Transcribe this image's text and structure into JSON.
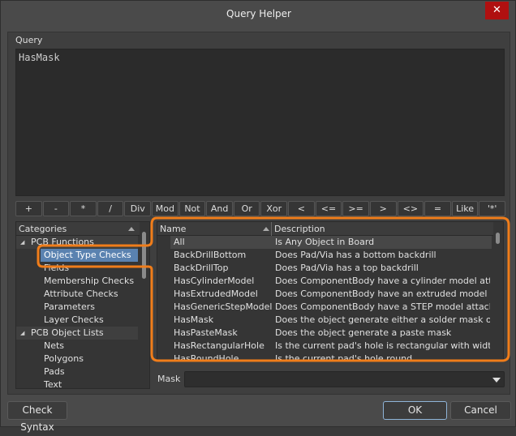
{
  "window": {
    "title": "Query Helper",
    "close_icon": "close-icon"
  },
  "query": {
    "label": "Query",
    "value": "HasMask"
  },
  "operators": [
    "+",
    "-",
    "*",
    "/",
    "Div",
    "Mod",
    "Not",
    "And",
    "Or",
    "Xor",
    "<",
    "<=",
    ">=",
    ">",
    "<>",
    "=",
    "Like",
    "'*'"
  ],
  "categories": {
    "header": "Categories",
    "items": [
      {
        "label": "PCB Functions",
        "level": 0,
        "expanded": true
      },
      {
        "label": "Object Type Checks",
        "level": 1,
        "selected": true
      },
      {
        "label": "Fields",
        "level": 1
      },
      {
        "label": "Membership Checks",
        "level": 1
      },
      {
        "label": "Attribute Checks",
        "level": 1
      },
      {
        "label": "Parameters",
        "level": 1
      },
      {
        "label": "Layer Checks",
        "level": 1
      },
      {
        "label": "PCB Object Lists",
        "level": 0,
        "expanded": true
      },
      {
        "label": "Nets",
        "level": 1
      },
      {
        "label": "Polygons",
        "level": 1
      },
      {
        "label": "Pads",
        "level": 1
      },
      {
        "label": "Text",
        "level": 1
      }
    ]
  },
  "list": {
    "columns": [
      "Name",
      "Description"
    ],
    "rows": [
      {
        "name": "All",
        "description": "Is Any Object in Board",
        "selected": true
      },
      {
        "name": "BackDrillBottom",
        "description": "Does Pad/Via has a bottom backdrill"
      },
      {
        "name": "BackDrillTop",
        "description": "Does Pad/Via has a top backdrill"
      },
      {
        "name": "HasCylinderModel",
        "description": "Does ComponentBody have a cylinder model attache"
      },
      {
        "name": "HasExtrudedModel",
        "description": "Does ComponentBody have an extruded model attac"
      },
      {
        "name": "HasGenericStepModel",
        "description": "Does ComponentBody have a STEP model attached ("
      },
      {
        "name": "HasMask",
        "description": "Does the object generate either a solder mask or a p"
      },
      {
        "name": "HasPasteMask",
        "description": "Does the object generate a paste mask"
      },
      {
        "name": "HasRectangularHole",
        "description": "Is the current pad's hole is rectangular with width <"
      },
      {
        "name": "HasRoundHole",
        "description": "Is the current pad's hole round"
      }
    ]
  },
  "mask": {
    "label": "Mask",
    "value": ""
  },
  "buttons": {
    "check_syntax": "Check Syntax",
    "ok": "OK",
    "cancel": "Cancel"
  },
  "colors": {
    "accent": "#f07d1a",
    "selection": "#5a82b0",
    "close": "#b01010"
  }
}
